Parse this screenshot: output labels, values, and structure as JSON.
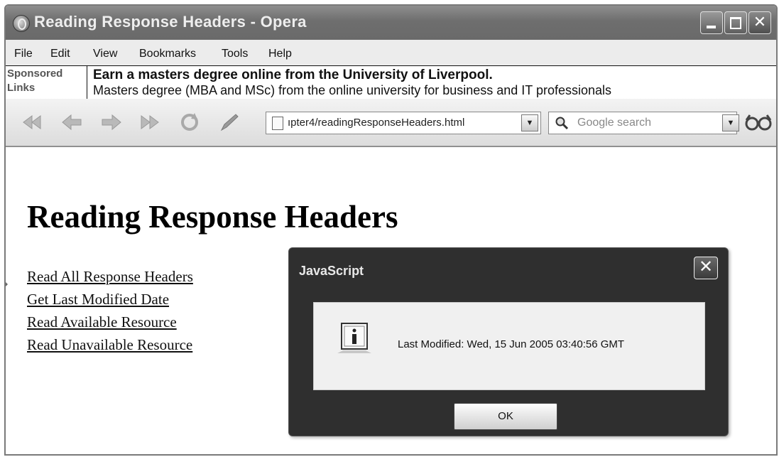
{
  "window": {
    "title": "Reading Response Headers - Opera"
  },
  "menu": {
    "items": [
      "File",
      "Edit",
      "View",
      "Bookmarks",
      "Tools",
      "Help"
    ]
  },
  "sponsored": {
    "label_line1": "Sponsored",
    "label_line2": "Links",
    "headline": "Earn a masters degree online from the University of Liverpool.",
    "description": "Masters degree (MBA and MSc) from the online university for business and IT professionals"
  },
  "toolbar": {
    "address": "ıpter4/readingResponseHeaders.html",
    "search_placeholder": "Google search"
  },
  "page": {
    "heading": "Reading Response Headers",
    "links": [
      "Read All Response Headers",
      "Get Last Modified Date",
      "Read Available Resource",
      "Read Unavailable Resource"
    ]
  },
  "dialog": {
    "title": "JavaScript",
    "message": "Last Modified: Wed, 15 Jun 2005 03:40:56 GMT",
    "ok_label": "OK",
    "icon": "info-icon"
  }
}
